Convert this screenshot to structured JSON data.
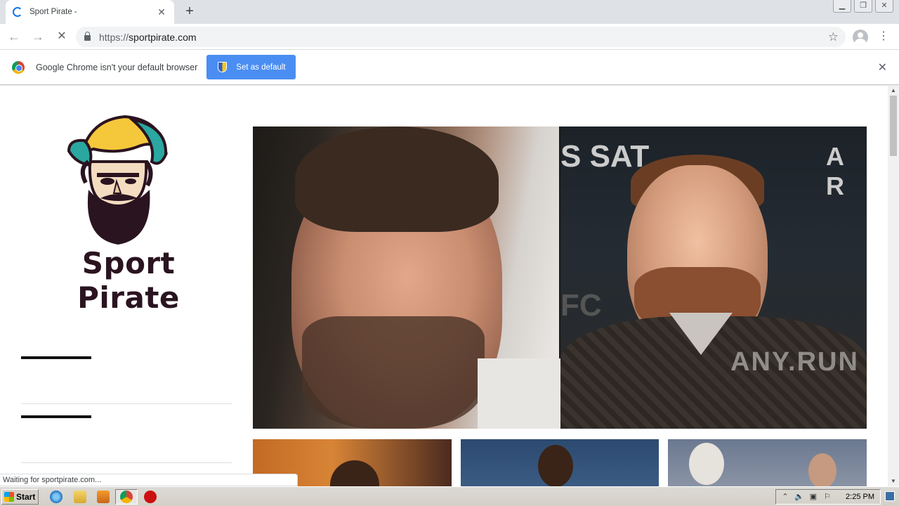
{
  "browser": {
    "tab": {
      "title": "Sport Pirate -"
    },
    "url": {
      "scheme": "https://",
      "host": "sportpirate.com"
    },
    "window_buttons": [
      "minimize",
      "restore",
      "close"
    ]
  },
  "infobar": {
    "message": "Google Chrome isn't your default browser",
    "button_label": "Set as default"
  },
  "page": {
    "logo_text": "Sport Pirate",
    "hero_background_text": [
      "S SAT",
      "A R",
      "FC"
    ]
  },
  "status_text": "Waiting for sportpirate.com...",
  "watermark": "ANY.RUN",
  "taskbar": {
    "start_label": "Start",
    "clock": "2:25 PM"
  },
  "colors": {
    "accent_blue": "#4a8ef3",
    "logo_text": "#2a1420",
    "turban_yellow": "#f5c73a",
    "turban_teal": "#2aa7a0"
  }
}
